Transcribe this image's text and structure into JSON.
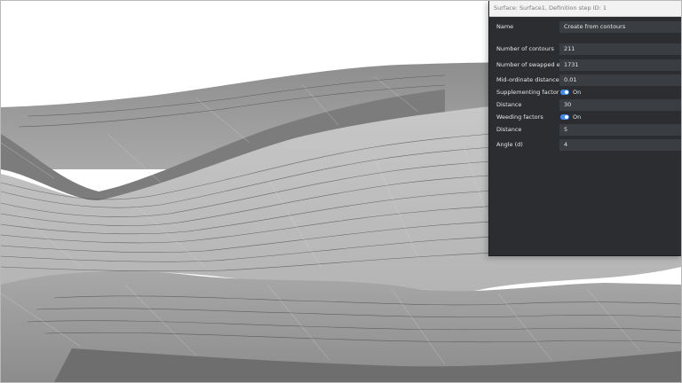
{
  "panel": {
    "title": "Surface: Surface1, Definition step ID: 1",
    "name_label": "Name",
    "name_value": "Create from contours",
    "fields": {
      "num_contours": {
        "label": "Number of contours",
        "value": "211"
      },
      "num_swapped": {
        "label": "Number of swapped edges",
        "value": "1731"
      },
      "mid_ordinate": {
        "label": "Mid-ordinate distance",
        "value": "0.01"
      },
      "supplementing": {
        "label": "Supplementing factor",
        "state": "On"
      },
      "distance1": {
        "label": "Distance",
        "value": "30"
      },
      "weeding": {
        "label": "Weeding factors",
        "state": "On"
      },
      "distance2": {
        "label": "Distance",
        "value": "5"
      },
      "angle": {
        "label": "Angle (d)",
        "value": "4"
      }
    },
    "colors": {
      "toggle_on": "#3f8cff",
      "panel_bg": "#2b2d31"
    }
  },
  "viewport": {
    "content": "3D surface mesh with contour lines"
  }
}
